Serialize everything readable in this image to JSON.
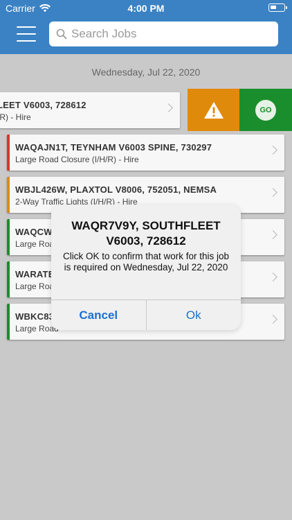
{
  "status": {
    "carrier": "Carrier",
    "time": "4:00 PM"
  },
  "search": {
    "placeholder": "Search Jobs"
  },
  "date_heading": "Wednesday, Jul 22, 2020",
  "swiped_row": {
    "title": "LEET V6003, 728612",
    "subtitle": "/R) - Hire"
  },
  "actions": {
    "go_label": "GO"
  },
  "rows": [
    {
      "title": "WAQAJN1T, TEYNHAM V6003 SPINE, 730297",
      "subtitle": "Large Road Closure (I/H/R) - Hire",
      "color": "#d9352b"
    },
    {
      "title": "WBJL426W, PLAXTOL V8006, 752051, NEMSA",
      "subtitle": "2-Way Traffic Lights (I/H/R) - Hire",
      "color": "#e08a0b"
    },
    {
      "title": "WAQCWU",
      "subtitle": "Large Road",
      "color": "#1a8e2c"
    },
    {
      "title": "WARATE",
      "subtitle": "Large Road",
      "color": "#1a8e2c"
    },
    {
      "title": "WBKC83",
      "subtitle": "Large Road",
      "color": "#1a8e2c"
    }
  ],
  "alert": {
    "title": "WAQR7V9Y, SOUTHFLEET V6003, 728612",
    "message": "Click OK to confirm that work for this job is required on Wednesday, Jul 22, 2020",
    "cancel_label": "Cancel",
    "ok_label": "Ok"
  },
  "colors": {
    "header": "#3a82c4",
    "warn": "#e08a0b",
    "go": "#1a8e2c",
    "link": "#1a6fd1"
  }
}
